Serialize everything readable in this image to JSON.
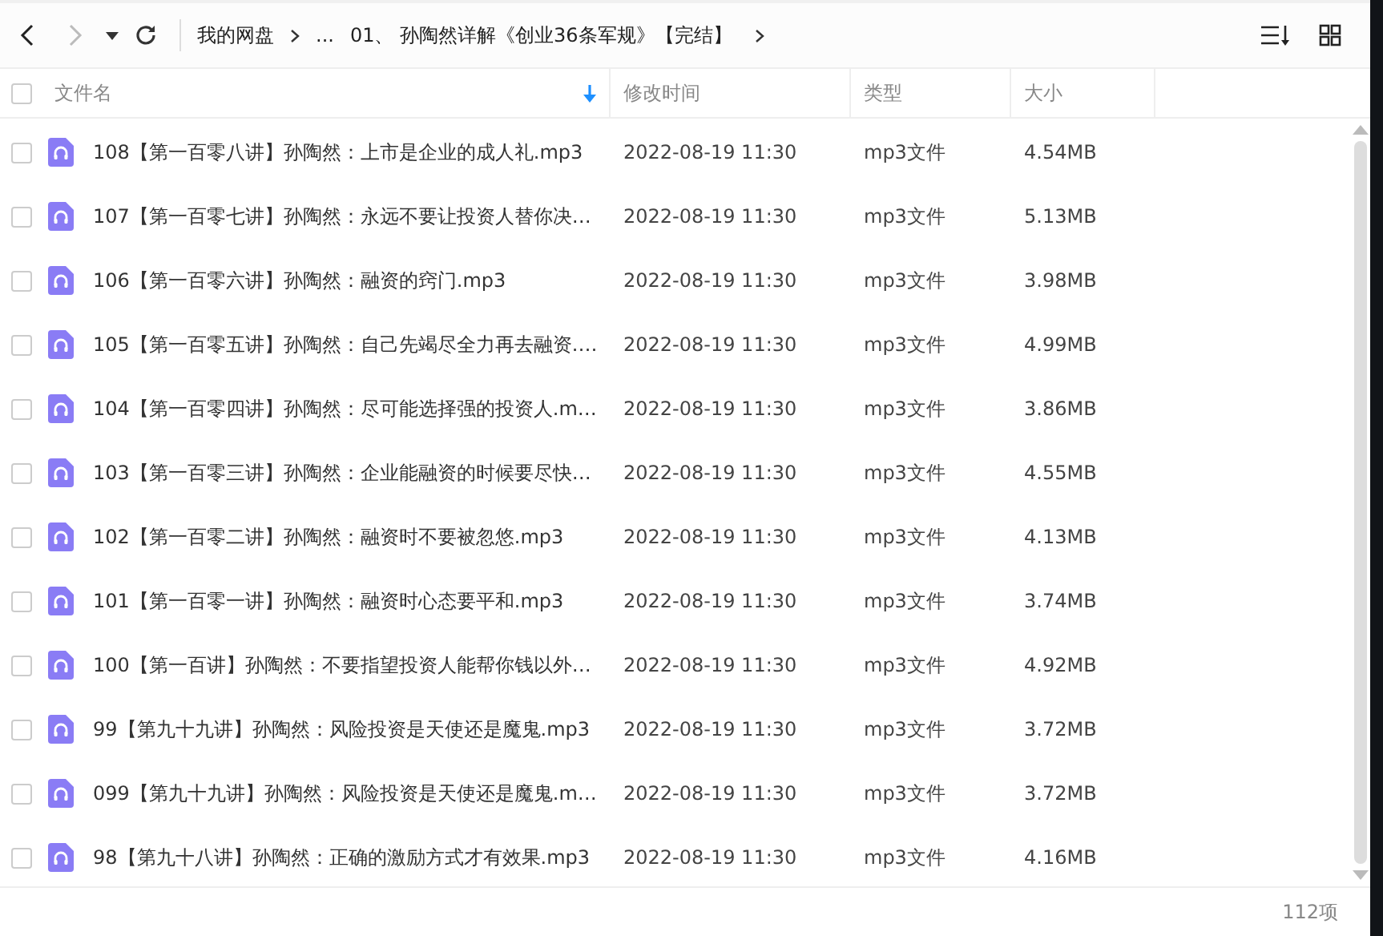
{
  "toolbar": {
    "back": {
      "disabled": false
    },
    "forward": {
      "disabled": true
    },
    "breadcrumbs": [
      "我的网盘",
      "...",
      "01、 孙陶然详解《创业36条军规》【完结】"
    ]
  },
  "table": {
    "select_all": {
      "checked": false
    },
    "columns": [
      {
        "label": "文件名",
        "sorted": true
      },
      {
        "label": "修改时间",
        "sorted": false
      },
      {
        "label": "类型",
        "sorted": false
      },
      {
        "label": "大小",
        "sorted": false
      }
    ],
    "rows": [
      {
        "checked": false,
        "name": "108【第一百零八讲】孙陶然：上市是企业的成人礼.mp3",
        "modified": "2022-08-19 11:30",
        "type": "mp3文件",
        "size": "4.54MB"
      },
      {
        "checked": false,
        "name": "107【第一百零七讲】孙陶然：永远不要让投资人替你决…",
        "modified": "2022-08-19 11:30",
        "type": "mp3文件",
        "size": "5.13MB"
      },
      {
        "checked": false,
        "name": "106【第一百零六讲】孙陶然：融资的窍门.mp3",
        "modified": "2022-08-19 11:30",
        "type": "mp3文件",
        "size": "3.98MB"
      },
      {
        "checked": false,
        "name": "105【第一百零五讲】孙陶然：自己先竭尽全力再去融资.…",
        "modified": "2022-08-19 11:30",
        "type": "mp3文件",
        "size": "4.99MB"
      },
      {
        "checked": false,
        "name": "104【第一百零四讲】孙陶然：尽可能选择强的投资人.m…",
        "modified": "2022-08-19 11:30",
        "type": "mp3文件",
        "size": "3.86MB"
      },
      {
        "checked": false,
        "name": "103【第一百零三讲】孙陶然：企业能融资的时候要尽快…",
        "modified": "2022-08-19 11:30",
        "type": "mp3文件",
        "size": "4.55MB"
      },
      {
        "checked": false,
        "name": "102【第一百零二讲】孙陶然：融资时不要被忽悠.mp3",
        "modified": "2022-08-19 11:30",
        "type": "mp3文件",
        "size": "4.13MB"
      },
      {
        "checked": false,
        "name": "101【第一百零一讲】孙陶然：融资时心态要平和.mp3",
        "modified": "2022-08-19 11:30",
        "type": "mp3文件",
        "size": "3.74MB"
      },
      {
        "checked": false,
        "name": "100【第一百讲】孙陶然：不要指望投资人能帮你钱以外…",
        "modified": "2022-08-19 11:30",
        "type": "mp3文件",
        "size": "4.92MB"
      },
      {
        "checked": false,
        "name": "99【第九十九讲】孙陶然：风险投资是天使还是魔鬼.mp3",
        "modified": "2022-08-19 11:30",
        "type": "mp3文件",
        "size": "3.72MB"
      },
      {
        "checked": false,
        "name": "099【第九十九讲】孙陶然：风险投资是天使还是魔鬼.m…",
        "modified": "2022-08-19 11:30",
        "type": "mp3文件",
        "size": "3.72MB"
      },
      {
        "checked": false,
        "name": "98【第九十八讲】孙陶然：正确的激励方式才有效果.mp3",
        "modified": "2022-08-19 11:30",
        "type": "mp3文件",
        "size": "4.16MB"
      }
    ]
  },
  "status_bar": {
    "count": "112项"
  }
}
